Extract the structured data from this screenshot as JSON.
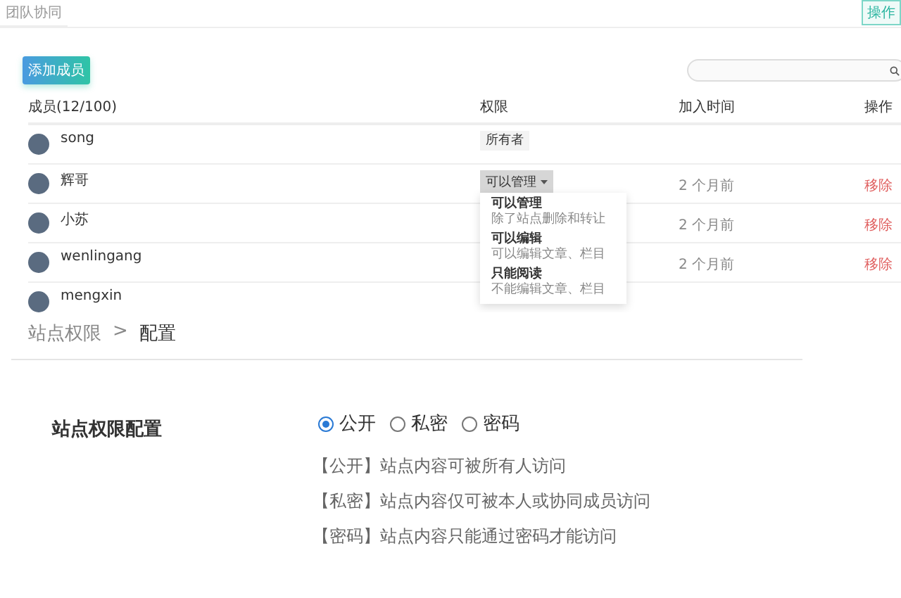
{
  "app_title": "团队协同",
  "corner_tag": "操作",
  "add_button": "添加成员",
  "table": {
    "columns": [
      "成员(12/100)",
      "权限",
      "加入时间",
      "操作"
    ],
    "rows": [
      {
        "name": "song",
        "role": {
          "kind": "tag",
          "label": "所有者"
        }
      },
      {
        "name": "辉哥",
        "role": {
          "kind": "dropdown",
          "label": "可以管理",
          "expanded": true
        },
        "joined": "2 个月前",
        "action": "移除"
      },
      {
        "name": "小苏",
        "joined": "2 个月前",
        "action": "移除"
      },
      {
        "name": "wenlingang",
        "joined": "2 个月前",
        "action": "移除"
      },
      {
        "name": "mengxin"
      }
    ]
  },
  "role_menu": [
    {
      "title": "可以管理",
      "desc": "除了站点删除和转让"
    },
    {
      "title": "可以编辑",
      "desc": "可以编辑文章、栏目"
    },
    {
      "title": "只能阅读",
      "desc": "不能编辑文章、栏目"
    }
  ],
  "breadcrumb": {
    "items": [
      "站点权限",
      "配置"
    ],
    "separator": ">"
  },
  "settings": {
    "label": "站点权限配置",
    "options": [
      {
        "label": "公开",
        "selected": true
      },
      {
        "label": "私密",
        "selected": false
      },
      {
        "label": "密码",
        "selected": false
      }
    ],
    "notes": [
      "【公开】站点内容可被所有人访问",
      "【私密】站点内容仅可被本人或协同成员访问",
      "【密码】站点内容只能通过密码才能访问"
    ]
  }
}
